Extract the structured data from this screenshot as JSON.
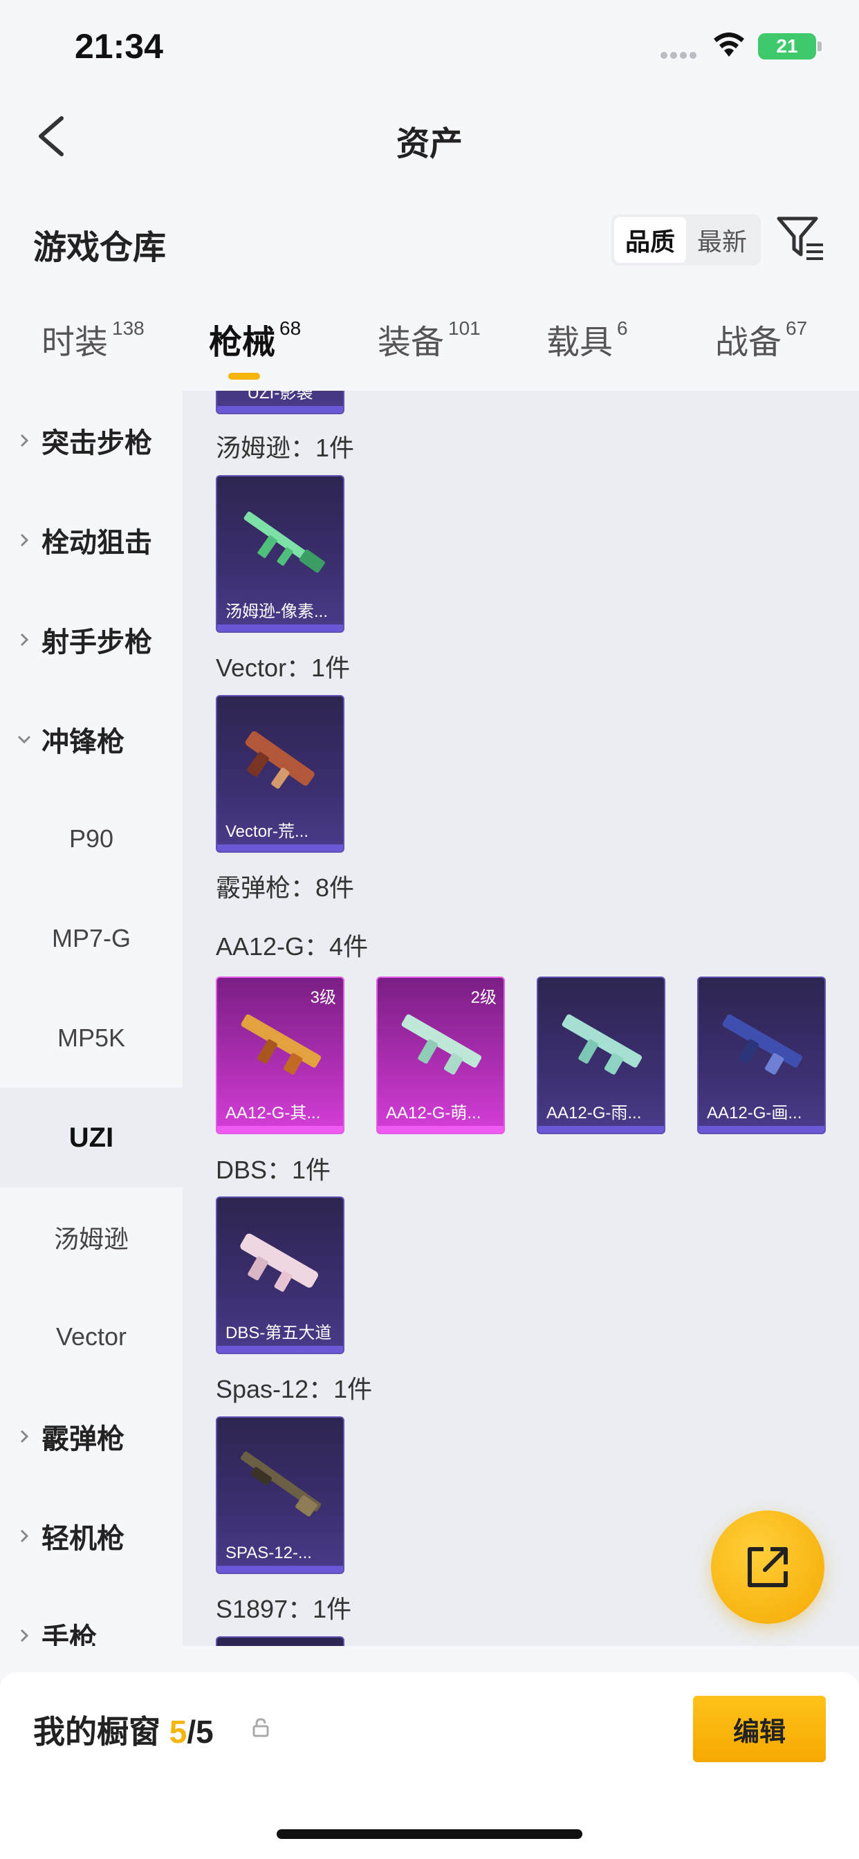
{
  "status": {
    "time": "21:34",
    "battery": "21"
  },
  "nav": {
    "title": "资产"
  },
  "warehouse": {
    "title": "游戏仓库",
    "sort_options": [
      "品质",
      "最新"
    ]
  },
  "tabs": [
    {
      "label": "时装",
      "count": "138"
    },
    {
      "label": "枪械",
      "count": "68"
    },
    {
      "label": "装备",
      "count": "101"
    },
    {
      "label": "载具",
      "count": "6"
    },
    {
      "label": "战备",
      "count": "67"
    }
  ],
  "sidebar": {
    "items": [
      "突击步枪",
      "栓动狙击",
      "射手步枪",
      "冲锋枪",
      "P90",
      "MP7-G",
      "MP5K",
      "UZI",
      "汤姆逊",
      "Vector",
      "霰弹枪",
      "轻机枪",
      "手枪"
    ]
  },
  "content": {
    "partial_top_card": "UZI-影袭",
    "groups": {
      "thompson": "汤姆逊：1件",
      "vector": "Vector：1件",
      "shotgun": "霰弹枪：8件",
      "aa12": "AA12-G：4件",
      "dbs": "DBS：1件",
      "spas": "Spas-12：1件",
      "s1897": "S1897：1件"
    },
    "cards": {
      "thompson_1": "汤姆逊-像素...",
      "vector_1": "Vector-荒...",
      "aa12_1": "AA12-G-其...",
      "aa12_1_level": "3级",
      "aa12_2": "AA12-G-萌...",
      "aa12_2_level": "2级",
      "aa12_3": "AA12-G-雨...",
      "aa12_4": "AA12-G-画...",
      "dbs_1": "DBS-第五大道",
      "spas_1": "SPAS-12-..."
    }
  },
  "showcase": {
    "label": "我的橱窗",
    "count": "5",
    "total": "/5",
    "edit": "编辑"
  }
}
